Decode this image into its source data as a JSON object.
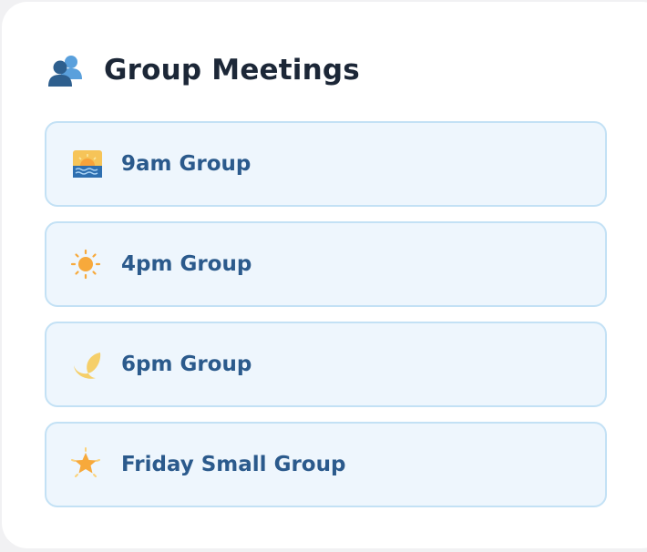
{
  "panel": {
    "title": "Group Meetings",
    "title_icon": "busts-in-silhouette-icon"
  },
  "groups": [
    {
      "label": "9am Group",
      "icon": "sunrise-icon"
    },
    {
      "label": "4pm Group",
      "icon": "sun-icon"
    },
    {
      "label": "6pm Group",
      "icon": "crescent-moon-icon"
    },
    {
      "label": "Friday Small Group",
      "icon": "star-icon"
    }
  ],
  "colors": {
    "title_text": "#1c2737",
    "item_text": "#2b5a8c",
    "item_background": "#eef6fd",
    "item_border": "#c3e1f5"
  }
}
